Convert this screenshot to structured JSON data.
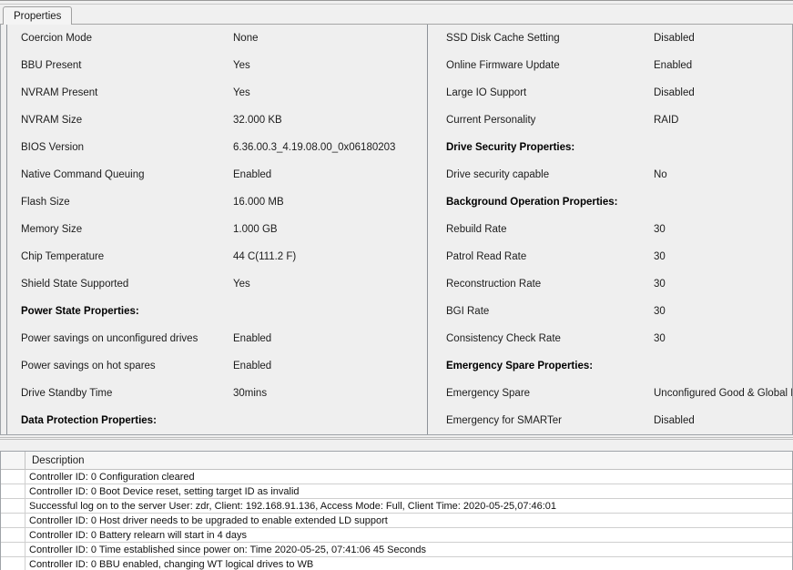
{
  "window": {
    "tabs": [
      {
        "label": "Properties",
        "selected": true
      }
    ]
  },
  "properties": {
    "left_column": [
      {
        "key": "Coercion Mode",
        "value": "None",
        "section": false
      },
      {
        "key": "BBU Present",
        "value": "Yes",
        "section": false
      },
      {
        "key": "NVRAM Present",
        "value": "Yes",
        "section": false
      },
      {
        "key": "NVRAM Size",
        "value": "32.000 KB",
        "section": false
      },
      {
        "key": "BIOS Version",
        "value": "6.36.00.3_4.19.08.00_0x06180203",
        "section": false
      },
      {
        "key": "Native Command Queuing",
        "value": "Enabled",
        "section": false
      },
      {
        "key": "Flash Size",
        "value": "16.000 MB",
        "section": false
      },
      {
        "key": "Memory Size",
        "value": "1.000 GB",
        "section": false
      },
      {
        "key": "Chip Temperature",
        "value": "44 C(111.2 F)",
        "section": false
      },
      {
        "key": "Shield State Supported",
        "value": "Yes",
        "section": false
      },
      {
        "key": "Power State Properties:",
        "value": "",
        "section": true
      },
      {
        "key": "Power savings on unconfigured drives",
        "value": "Enabled",
        "section": false
      },
      {
        "key": "Power savings on hot spares",
        "value": "Enabled",
        "section": false
      },
      {
        "key": "Drive Standby Time",
        "value": "30mins",
        "section": false
      },
      {
        "key": "Data Protection Properties:",
        "value": "",
        "section": true
      }
    ],
    "right_column": [
      {
        "key": "SSD Disk Cache Setting",
        "value": "Disabled",
        "section": false
      },
      {
        "key": "Online Firmware Update",
        "value": "Enabled",
        "section": false
      },
      {
        "key": "Large IO Support",
        "value": "Disabled",
        "section": false
      },
      {
        "key": "Current Personality",
        "value": "RAID",
        "section": false
      },
      {
        "key": "Drive Security Properties:",
        "value": "",
        "section": true
      },
      {
        "key": "Drive security capable",
        "value": "No",
        "section": false
      },
      {
        "key": "Background Operation Properties:",
        "value": "",
        "section": true
      },
      {
        "key": "Rebuild Rate",
        "value": "30",
        "section": false
      },
      {
        "key": "Patrol Read Rate",
        "value": "30",
        "section": false
      },
      {
        "key": "Reconstruction Rate",
        "value": "30",
        "section": false
      },
      {
        "key": "BGI Rate",
        "value": "30",
        "section": false
      },
      {
        "key": "Consistency Check Rate",
        "value": "30",
        "section": false
      },
      {
        "key": "Emergency Spare Properties:",
        "value": "",
        "section": true
      },
      {
        "key": "Emergency Spare",
        "value": "Unconfigured Good & Global Hotspare",
        "section": false
      },
      {
        "key": "Emergency for SMARTer",
        "value": "Disabled",
        "section": false
      }
    ]
  },
  "log": {
    "columns": [
      "Description"
    ],
    "rows": [
      {
        "description": "Controller ID: 0 Configuration cleared"
      },
      {
        "description": "Controller ID: 0 Boot Device reset, setting target ID as invalid"
      },
      {
        "description": "Successful log on to the server User:  zdr, Client:  192.168.91.136,    Access Mode:  Full, Client Time:  2020-05-25,07:46:01"
      },
      {
        "description": "Controller ID:  0  Host driver needs to be upgraded   to enable extended LD support"
      },
      {
        "description": "Controller ID:  0  Battery relearn will start in 4 days"
      },
      {
        "description": "Controller ID:  0  Time established since power on:  Time   2020-05-25, 07:41:06     45  Seconds"
      },
      {
        "description": "Controller ID:  0  BBU enabled, changing WT logical drives to WB"
      }
    ]
  }
}
